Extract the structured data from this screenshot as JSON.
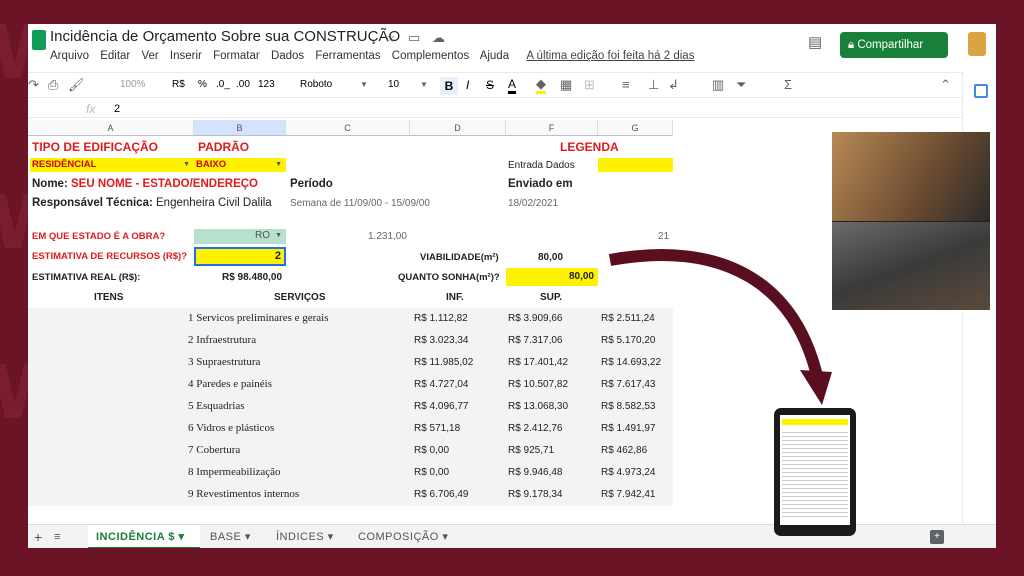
{
  "doc": {
    "title": "Incidência de Orçamento Sobre sua CONSTRUÇÃO",
    "menu": [
      "Arquivo",
      "Editar",
      "Ver",
      "Inserir",
      "Formatar",
      "Dados",
      "Ferramentas",
      "Complementos",
      "Ajuda"
    ],
    "last_edit": "A última edição foi feita há 2 dias",
    "share_label": "Compartilhar"
  },
  "toolbar": {
    "zoom": "100%",
    "currency": "R$",
    "percent": "%",
    "dec_less": ".0_",
    "dec_more": ".00",
    "format": "123",
    "font": "Roboto",
    "size": "10",
    "bold": "B",
    "italic": "I",
    "strike": "S",
    "textcolor": "A"
  },
  "formula": {
    "fx": "fx",
    "value": "2"
  },
  "columns": [
    "A",
    "B",
    "C",
    "D",
    "F",
    "G"
  ],
  "sheet": {
    "tipo_label": "TIPO DE EDIFICAÇÃO",
    "padrao_label": "PADRÃO",
    "legenda_label": "LEGENDA",
    "tipo_value": "RESIDÊNCIAL",
    "padrao_value": "BAIXO",
    "entrada_dados": "Entrada Dados",
    "nome_label": "Nome: ",
    "nome_value": "SEU NOME - ESTADO/ENDEREÇO",
    "periodo_label": "Período",
    "enviado_label": "Enviado em",
    "resp_label": "Responsável Técnica: ",
    "resp_value": "Engenheira Civil Dalila",
    "periodo_value": "Semana de 11/09/00 - 15/09/00",
    "enviado_value": "18/02/2021",
    "estado_label": "EM QUE ESTADO É A OBRA?",
    "estado_value": "RO",
    "estado_num": "1.231,00",
    "estado_idx": "21",
    "recursos_label": "ESTIMATIVA DE RECURSOS (R$)?",
    "recursos_value": "2",
    "viab_label": "VIABILIDADE(m²)",
    "viab_value": "80,00",
    "real_label": "ESTIMATIVA REAL (R$):",
    "real_value": "R$ 98.480,00",
    "sonha_label": "QUANTO SONHA(m²)?",
    "sonha_value": "80,00",
    "h_itens": "ITENS",
    "h_servicos": "SERVIÇOS",
    "h_inf": "INF.",
    "h_sup": "SUP."
  },
  "rows": [
    {
      "n": "1",
      "s": "Servicos preliminares e gerais",
      "inf": "R$ 1.112,82",
      "sup": "R$ 3.909,66",
      "g": "R$ 2.511,24"
    },
    {
      "n": "2",
      "s": "Infraestrutura",
      "inf": "R$ 3.023,34",
      "sup": "R$ 7.317,06",
      "g": "R$ 5.170,20"
    },
    {
      "n": "3",
      "s": "Supraestrutura",
      "inf": "R$ 11.985,02",
      "sup": "R$ 17.401,42",
      "g": "R$ 14.693,22"
    },
    {
      "n": "4",
      "s": "Paredes e painéis",
      "inf": "R$ 4.727,04",
      "sup": "R$ 10.507,82",
      "g": "R$ 7.617,43"
    },
    {
      "n": "5",
      "s": "Esquadrias",
      "inf": "R$ 4.096,77",
      "sup": "R$ 13.068,30",
      "g": "R$ 8.582,53"
    },
    {
      "n": "6",
      "s": "Vidros e plásticos",
      "inf": "R$ 571,18",
      "sup": "R$ 2.412,76",
      "g": "R$ 1.491,97"
    },
    {
      "n": "7",
      "s": "Cobertura",
      "inf": "R$ 0,00",
      "sup": "R$ 925,71",
      "g": "R$ 462,86"
    },
    {
      "n": "8",
      "s": "Impermeabilização",
      "inf": "R$ 0,00",
      "sup": "R$ 9.946,48",
      "g": "R$ 4.973,24"
    },
    {
      "n": "9",
      "s": "Revestimentos internos",
      "inf": "R$ 6.706,49",
      "sup": "R$ 9.178,34",
      "g": "R$ 7.942,41"
    }
  ],
  "tabs": [
    "INCIDÊNCIA $",
    "BASE",
    "ÍNDICES",
    "COMPOSIÇÃO"
  ],
  "add_sheet": "+",
  "colors": {
    "accent_green": "#188038",
    "background": "#6b1426",
    "highlight": "#fff200",
    "label_red": "#e01b1b"
  }
}
